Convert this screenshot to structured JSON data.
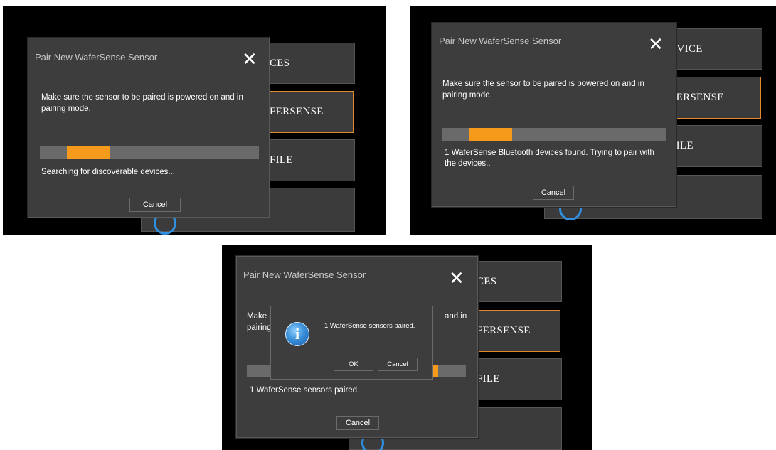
{
  "colors": {
    "panel_bg": "#000000",
    "dialog_bg": "#3d3d3d",
    "accent_progress": "#f59a1b",
    "accent_border": "#e0882a",
    "progress_track": "#6a6a6a",
    "info_blue": "#2f8fe0"
  },
  "panels": [
    {
      "background_buttons": [
        "CES",
        "FERSENSE",
        "FILE"
      ],
      "dialog": {
        "title": "Pair New WaferSense Sensor",
        "close_icon": "close-icon",
        "message": "Make sure the sensor to be paired is powered on and in pairing mode.",
        "progress": 0.2,
        "status": "Searching for discoverable devices...",
        "cancel_label": "Cancel"
      }
    },
    {
      "background_buttons": [
        "EVICE",
        "FERSENSE",
        "FILE"
      ],
      "dialog": {
        "title": "Pair New WaferSense Sensor",
        "close_icon": "close-icon",
        "message": "Make sure the sensor to be paired is powered on and in pairing mode.",
        "progress": 0.2,
        "status": "1 WaferSense Bluetooth devices found.  Trying to pair with the devices..",
        "cancel_label": "Cancel"
      }
    },
    {
      "background_buttons": [
        "CES",
        "FERSENSE",
        "FILE"
      ],
      "dialog": {
        "title": "Pair New WaferSense Sensor",
        "close_icon": "close-icon",
        "message_left_1": "Make s",
        "message_left_2": "pairing",
        "message_right": "and in",
        "status": "1 WaferSense sensors paired.",
        "cancel_label": "Cancel"
      },
      "message_box": {
        "icon": "info-icon",
        "icon_glyph": "i",
        "text": "1 WaferSense sensors paired.",
        "ok_label": "OK",
        "cancel_label": "Cancel"
      }
    }
  ]
}
